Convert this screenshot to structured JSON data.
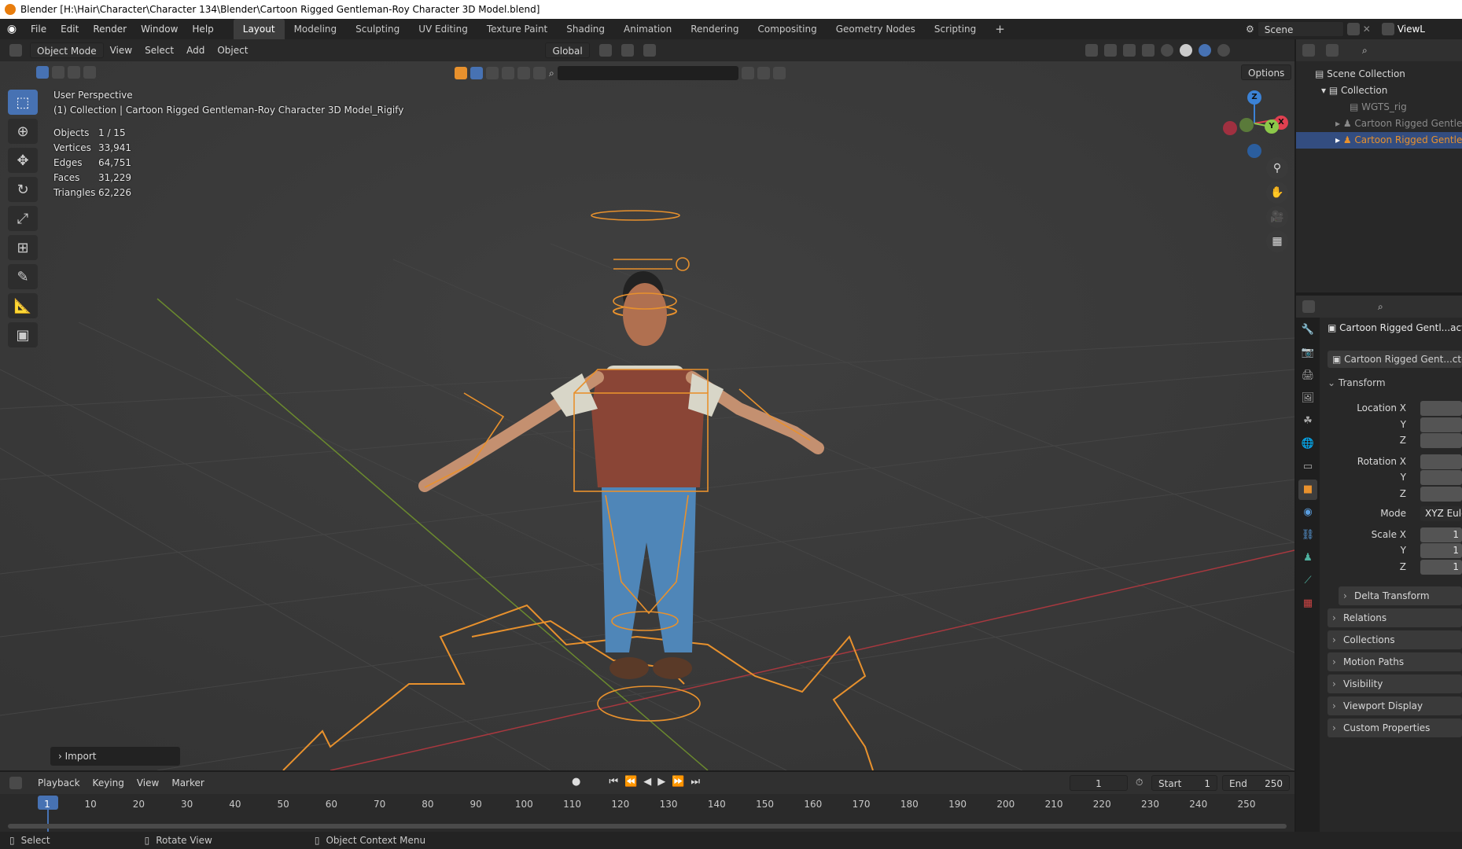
{
  "title": "Blender [H:\\Hair\\Character\\Character 134\\Blender\\Cartoon Rigged Gentleman-Roy Character 3D Model.blend]",
  "menu": [
    "File",
    "Edit",
    "Render",
    "Window",
    "Help"
  ],
  "workspaces": [
    "Layout",
    "Modeling",
    "Sculpting",
    "UV Editing",
    "Texture Paint",
    "Shading",
    "Animation",
    "Rendering",
    "Compositing",
    "Geometry Nodes",
    "Scripting"
  ],
  "active_workspace": "Layout",
  "scene_name": "Scene",
  "view_layer": "ViewL",
  "viewport_header": {
    "mode": "Object Mode",
    "menus": [
      "View",
      "Select",
      "Add",
      "Object"
    ],
    "transform_orientation": "Global",
    "options": "Options"
  },
  "overlay": {
    "perspective": "User Perspective",
    "collection": "(1) Collection | Cartoon Rigged Gentleman-Roy Character 3D Model_Rigify",
    "stats": [
      {
        "k": "Objects",
        "v": "1 / 15"
      },
      {
        "k": "Vertices",
        "v": "33,941"
      },
      {
        "k": "Edges",
        "v": "64,751"
      },
      {
        "k": "Faces",
        "v": "31,229"
      },
      {
        "k": "Triangles",
        "v": "62,226"
      }
    ]
  },
  "gizmo": {
    "z": "Z",
    "y": "Y",
    "x": "X"
  },
  "last_op": "Import",
  "outliner": {
    "items": [
      {
        "label": "Scene Collection",
        "state": "normal"
      },
      {
        "label": "Collection",
        "state": "normal"
      },
      {
        "label": "WGTS_rig",
        "state": "dim"
      },
      {
        "label": "Cartoon Rigged Gentlem",
        "state": "dim"
      },
      {
        "label": "Cartoon Rigged Gentlem",
        "state": "selected"
      }
    ]
  },
  "properties": {
    "object_name": "Cartoon Rigged Gentl...acte",
    "data_name": "Cartoon Rigged Gent...cte",
    "transform": "Transform",
    "location_label": "Location X",
    "rotation_label": "Rotation X",
    "mode_label": "Mode",
    "mode_value": "XYZ Eule",
    "scale_label": "Scale X",
    "scale_values": [
      "1",
      "1",
      "1"
    ],
    "y": "Y",
    "z": "Z",
    "sections": [
      "Delta Transform",
      "Relations",
      "Collections",
      "Motion Paths",
      "Visibility",
      "Viewport Display",
      "Custom Properties"
    ]
  },
  "timeline": {
    "menus": [
      "Playback",
      "Keying",
      "View",
      "Marker"
    ],
    "current_frame": "1",
    "start_label": "Start",
    "start": "1",
    "end_label": "End",
    "end": "250",
    "ticks": [
      "1",
      "10",
      "20",
      "30",
      "40",
      "50",
      "60",
      "70",
      "80",
      "90",
      "100",
      "110",
      "120",
      "130",
      "140",
      "150",
      "160",
      "170",
      "180",
      "190",
      "200",
      "210",
      "220",
      "230",
      "240",
      "250"
    ]
  },
  "status": {
    "select": "Select",
    "rotate": "Rotate View",
    "context": "Object Context Menu"
  },
  "colors": {
    "accent": "#4772b3",
    "selection": "#e8912d",
    "x_axis": "#e04050",
    "y_axis": "#8cc84a",
    "z_axis": "#3b82d6"
  }
}
